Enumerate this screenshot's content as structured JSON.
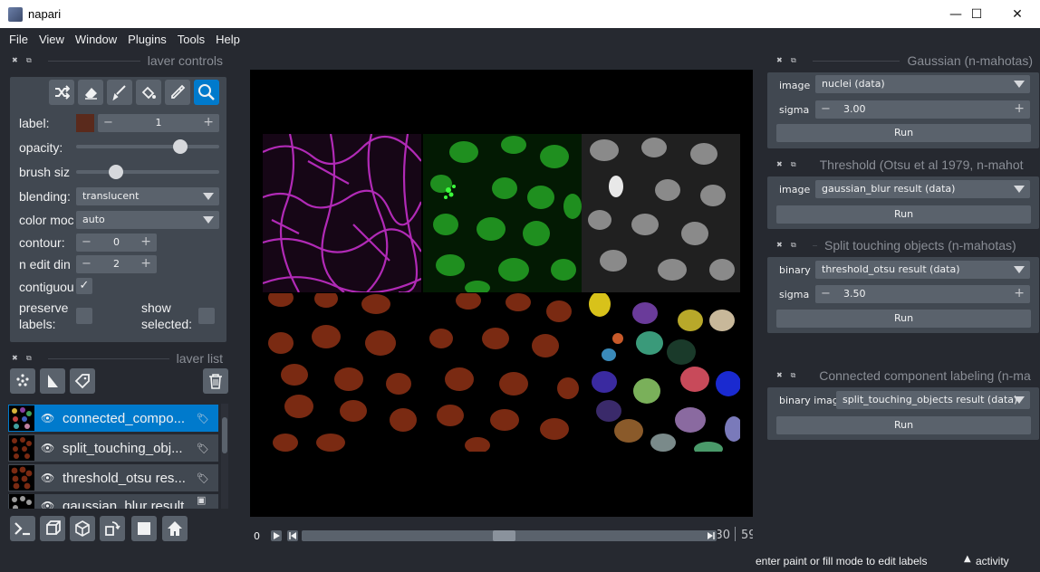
{
  "window": {
    "title": "napari",
    "minimize": "—",
    "maximize": "☐",
    "close": "✕"
  },
  "menu": [
    "File",
    "View",
    "Window",
    "Plugins",
    "Tools",
    "Help"
  ],
  "layer_controls": {
    "dock_title": "laver controls",
    "label_label": "label:",
    "label_value": "1",
    "opacity_label": "opacity:",
    "opacity_value": 0.75,
    "brush_label": "brush siz",
    "brush_value": 0.25,
    "blending_label": "blending:",
    "blending_value": "translucent",
    "color_mode_label": "color moc",
    "color_mode_value": "auto",
    "contour_label": "contour:",
    "contour_value": "0",
    "n_edit_label": "n edit din",
    "n_edit_value": "2",
    "contiguous_label": "contiguou",
    "contiguous_checked": "✓",
    "preserve_label_1": "preserve",
    "preserve_label_2": "labels:",
    "show_selected_label_1": "show",
    "show_selected_label_2": "selected:",
    "label_color": "#5a2a1c"
  },
  "layer_list": {
    "dock_title": "laver list",
    "layers": [
      {
        "name": "connected_compo...",
        "selected": true
      },
      {
        "name": "split_touching_obj...",
        "selected": false
      },
      {
        "name": "threshold_otsu res...",
        "selected": false
      },
      {
        "name": "gaussian_blur result",
        "selected": false
      }
    ]
  },
  "dims": {
    "start": "0",
    "end_a": "30",
    "end_b": "59"
  },
  "widgets": [
    {
      "title": "Gaussian (n-mahotas)",
      "fields": [
        {
          "label": "image",
          "type": "dropdown",
          "value": "nuclei (data)"
        },
        {
          "label": "sigma",
          "type": "spin",
          "value": "3.00"
        }
      ],
      "button": "Run"
    },
    {
      "title": "Threshold (Otsu et al 1979, n-mahot",
      "fields": [
        {
          "label": "image",
          "type": "dropdown",
          "value": "gaussian_blur result (data)"
        }
      ],
      "button": "Run"
    },
    {
      "title": "Split touching objects (n-mahotas)",
      "fields": [
        {
          "label": "binary",
          "type": "dropdown",
          "value": "threshold_otsu result (data)"
        },
        {
          "label": "sigma",
          "type": "spin",
          "value": "3.50"
        }
      ],
      "button": "Run"
    },
    {
      "title": "Connected component labeling (n-ma",
      "fields": [
        {
          "label": "binary imag",
          "type": "dropdown",
          "value": "split_touching_objects result (data)"
        }
      ],
      "button": "Run"
    }
  ],
  "status": {
    "message": "enter paint or fill mode to edit labels",
    "activity": "activity"
  },
  "colors": {
    "accent": "#007acc",
    "bg": "#262930",
    "panel": "#414851",
    "control": "#5a626c"
  }
}
